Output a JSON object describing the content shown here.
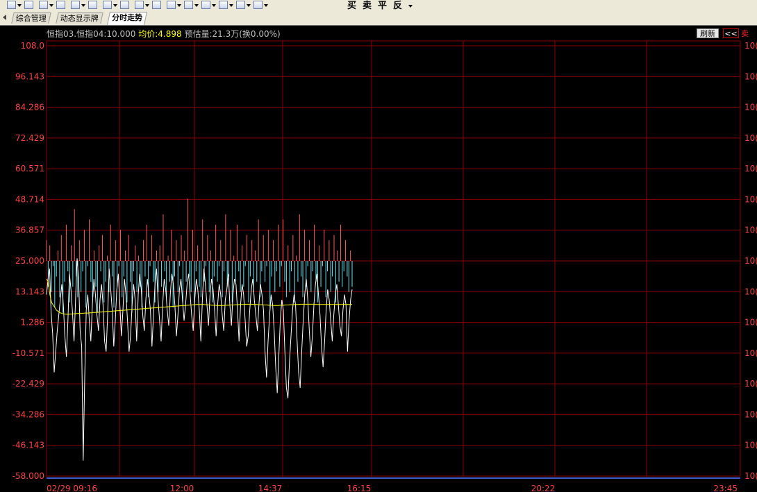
{
  "toolbar": {
    "icons": [
      "edit-icon",
      "pencil-icon",
      "list-icon",
      "bar-chart-icon",
      "line-chart-icon",
      "grid-icon",
      "layout-icon",
      "window-icon",
      "chart-zoom-icon",
      "text-icon",
      "calc-icon",
      "draw-icon",
      "clipboard-icon",
      "copy-icon",
      "table-icon",
      "export-icon"
    ],
    "trade_buttons": [
      "买",
      "卖",
      "平",
      "反"
    ]
  },
  "tabs": [
    {
      "label": "综合管理",
      "active": false
    },
    {
      "label": "动态显示牌",
      "active": false
    },
    {
      "label": "分时走势",
      "active": true
    }
  ],
  "header": {
    "symbol": "恒指03.恒指04:10.000",
    "avg_label": "均价:4.898",
    "estimate": "预估量:21.3万(换0.00%)",
    "refresh_label": "刷新",
    "collapse_label": "<<",
    "side_label": "卖"
  },
  "colors": {
    "background": "#000000",
    "grid": "#8b0000",
    "axis_label": "#ff4040",
    "up_bar": "#ff5a5a",
    "down_bar": "#66e8f5",
    "price_line": "#ffffff",
    "avg_line": "#ffff00"
  },
  "chart_data": {
    "type": "line",
    "y_left_ticks": [
      "108.0",
      "96.143",
      "84.286",
      "72.429",
      "60.571",
      "48.714",
      "36.857",
      "25.000",
      "13.143",
      "1.286",
      "-10.571",
      "-22.429",
      "-34.286",
      "-46.143",
      "-58.000"
    ],
    "y_right_ticks": [
      "10(",
      "10(",
      "10(",
      "10(",
      "10(",
      "10(",
      "10(",
      "10(",
      "10(",
      "10(",
      "10(",
      "10(",
      "10(",
      "10(",
      "10("
    ],
    "ylim": [
      -58.0,
      108.0
    ],
    "baseline": 25.0,
    "x_tick_labels": [
      "02/29 09:16",
      "12:00",
      "14:37",
      "16:15",
      "20:22",
      "23:45"
    ],
    "series": [
      {
        "values": [
          12,
          18,
          22,
          5,
          -3,
          -18,
          -10,
          -2,
          4,
          10,
          16,
          8,
          -4,
          -12,
          2,
          20,
          14,
          5,
          -6,
          10,
          26,
          18,
          -2,
          -8,
          -52,
          -20,
          6,
          12,
          2,
          -6,
          8,
          18,
          12,
          4,
          -2,
          10,
          16,
          8,
          -6,
          -10,
          4,
          22,
          14,
          6,
          -8,
          2,
          14,
          20,
          8,
          -4,
          6,
          18,
          12,
          2,
          -10,
          -4,
          8,
          16,
          10,
          -6,
          12,
          20,
          14,
          4,
          -2,
          10,
          18,
          12,
          6,
          -8,
          4,
          16,
          22,
          10,
          2,
          -6,
          8,
          18,
          14,
          6,
          0,
          12,
          20,
          16,
          8,
          -4,
          4,
          14,
          18,
          10,
          2,
          8,
          16,
          20,
          12,
          4,
          -2,
          10,
          18,
          14,
          6,
          -6,
          10,
          22,
          16,
          8,
          0,
          12,
          18,
          14,
          6,
          -4,
          8,
          16,
          12,
          4,
          -2,
          10,
          14,
          20,
          8,
          0,
          12,
          18,
          16,
          6,
          -6,
          8,
          16,
          12,
          2,
          -8,
          -4,
          6,
          14,
          18,
          10,
          4,
          -2,
          8,
          16,
          12,
          6,
          -10,
          -20,
          -6,
          4,
          12,
          8,
          -2,
          -16,
          -26,
          -12,
          2,
          10,
          6,
          -10,
          -24,
          -28,
          -14,
          -4,
          6,
          12,
          8,
          -6,
          -18,
          -24,
          -10,
          2,
          12,
          18,
          10,
          -2,
          -12,
          -4,
          8,
          16,
          20,
          12,
          4,
          -8,
          -16,
          -6,
          6,
          14,
          10,
          2,
          -6,
          4,
          12,
          16,
          8,
          0,
          -4,
          6,
          12,
          8,
          -10,
          2,
          10,
          14
        ]
      },
      {
        "values": [
          18,
          17,
          12,
          9,
          8,
          7,
          6,
          5.5,
          5,
          4.8,
          4.6,
          4.5,
          4.4,
          4.4,
          4.5,
          4.5,
          4.6,
          4.6,
          4.7,
          4.7,
          4.8,
          4.8,
          4.8,
          4.9,
          4.9,
          4.9,
          5.0,
          5.0,
          5.1,
          5.1,
          5.2,
          5.2,
          5.3,
          5.3,
          5.4,
          5.4,
          5.5,
          5.5,
          5.6,
          5.6,
          5.7,
          5.7,
          5.8,
          5.8,
          5.9,
          5.9,
          6.0,
          6.0,
          6.1,
          6.1,
          6.2,
          6.2,
          6.3,
          6.3,
          6.4,
          6.4,
          6.5,
          6.5,
          6.6,
          6.6,
          6.7,
          6.7,
          6.8,
          6.8,
          6.9,
          6.9,
          7.0,
          7.0,
          7.1,
          7.1,
          7.2,
          7.2,
          7.3,
          7.3,
          7.4,
          7.4,
          7.5,
          7.5,
          7.6,
          7.6,
          7.7,
          7.7,
          7.8,
          7.8,
          7.9,
          7.9,
          8.0,
          8.0,
          8.1,
          8.1,
          8.2,
          8.2,
          8.2,
          8.2,
          8.2,
          8.1,
          8.1,
          8.0,
          8.0,
          7.9,
          7.9,
          7.9,
          7.8,
          7.8,
          7.8,
          7.8,
          7.8,
          7.9,
          7.9,
          7.9,
          8.0,
          8.0,
          8.0,
          8.1,
          8.1,
          8.1,
          8.2,
          8.2,
          8.2,
          8.3,
          8.3,
          8.3,
          8.3,
          8.3,
          8.2,
          8.2,
          8.2,
          8.1,
          8.1,
          8.1,
          8.0,
          8.0,
          8.0,
          7.9,
          7.9,
          7.9,
          7.8,
          7.8,
          7.8,
          7.8,
          7.9,
          7.9,
          7.9,
          8.0,
          8.0,
          8.0,
          8.1,
          8.1,
          8.1,
          8.2,
          8.2,
          8.2,
          8.3,
          8.3,
          8.3,
          8.3,
          8.3,
          8.3,
          8.3,
          8.3,
          8.3,
          8.2,
          8.2,
          8.2,
          8.2,
          8.2,
          8.2,
          8.2,
          8.2,
          8.2,
          8.2,
          8.2,
          8.2,
          8.2,
          8.2,
          8.2,
          8.2,
          8.2,
          8.2,
          8.2,
          8.2,
          8.2,
          8.2,
          8.2
        ]
      },
      {
        "values": [
          8,
          -10,
          6,
          -12,
          -2,
          -18,
          -6,
          4,
          -14,
          10,
          -20,
          -8,
          14,
          -4,
          -16,
          6,
          -10,
          20,
          -6,
          -14,
          8,
          -12,
          -4,
          12,
          -18,
          -2,
          16,
          -8,
          -14,
          4,
          -10,
          -20,
          6,
          -4,
          10,
          -16,
          -8,
          2,
          -12,
          14,
          -6,
          -18,
          8,
          -10,
          -2,
          12,
          -14,
          -6,
          4,
          -16,
          10,
          -8,
          -20,
          -4,
          6,
          -12,
          2,
          -10,
          -18,
          8,
          -6,
          14,
          -14,
          -2,
          10,
          -8,
          -16,
          4,
          -12,
          6,
          -10,
          18,
          -4,
          -14,
          2,
          -8,
          12,
          -18,
          -6,
          8,
          -12,
          -2,
          10,
          -16,
          4,
          -8,
          24,
          -6,
          -12,
          12,
          -18,
          -4,
          6,
          -10,
          -14,
          16,
          -8,
          -2,
          10,
          -12,
          4,
          -16,
          -6,
          14,
          -8,
          -2,
          8,
          -14,
          -4,
          18,
          -10,
          -6,
          12,
          -16,
          2,
          -8,
          14,
          -4,
          -12,
          6,
          -10,
          -2,
          10,
          -16,
          -6,
          8,
          -12,
          4,
          -8,
          16,
          -14,
          -4,
          10,
          -8,
          -2,
          12,
          -18,
          -6,
          8,
          -12,
          -4,
          14,
          -10,
          -2,
          16,
          -8,
          -14,
          6,
          -12,
          -4,
          10,
          -16,
          2,
          -8,
          18,
          -6,
          -14,
          12,
          -10,
          -2,
          8,
          -12,
          -4,
          14,
          -8,
          -16,
          6,
          -10,
          -2,
          12,
          -14,
          -4,
          8,
          -12,
          -6,
          10,
          -16,
          4,
          -8,
          14,
          -10,
          -4,
          8,
          -6,
          -12,
          4,
          -10
        ]
      }
    ]
  }
}
